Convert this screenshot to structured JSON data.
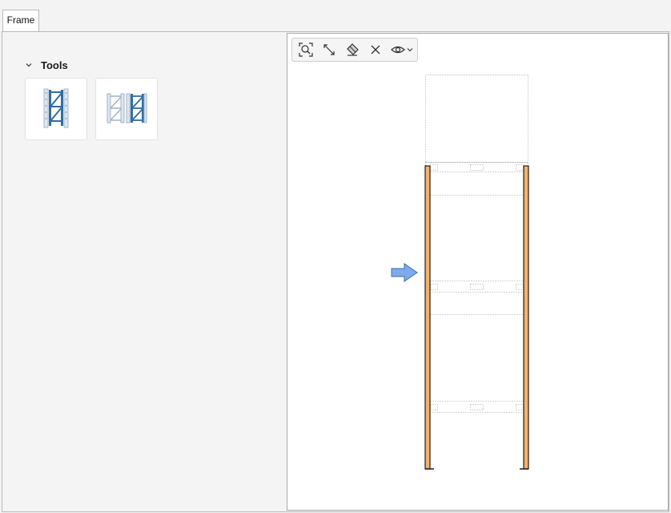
{
  "tabs": [
    {
      "label": "Frame",
      "active": true
    }
  ],
  "tools_panel": {
    "title": "Tools",
    "expanded": true,
    "items": [
      {
        "icon": "single-frame-icon"
      },
      {
        "icon": "double-frame-icon"
      }
    ]
  },
  "viewport_toolbar": {
    "buttons": [
      {
        "icon": "zoom-extents-icon"
      },
      {
        "icon": "dimension-icon"
      },
      {
        "icon": "erase-icon"
      },
      {
        "icon": "close-icon"
      },
      {
        "icon": "eye-icon",
        "has_dropdown": true
      }
    ]
  },
  "colors": {
    "upright_fill": "#f4b26a",
    "upright_outline": "#1e1e1e",
    "arrow_fill": "#7eaaea",
    "arrow_outline": "#3d6ab8",
    "icon_blue": "#2f6ea3",
    "icon_gray": "#a9b6c2"
  }
}
